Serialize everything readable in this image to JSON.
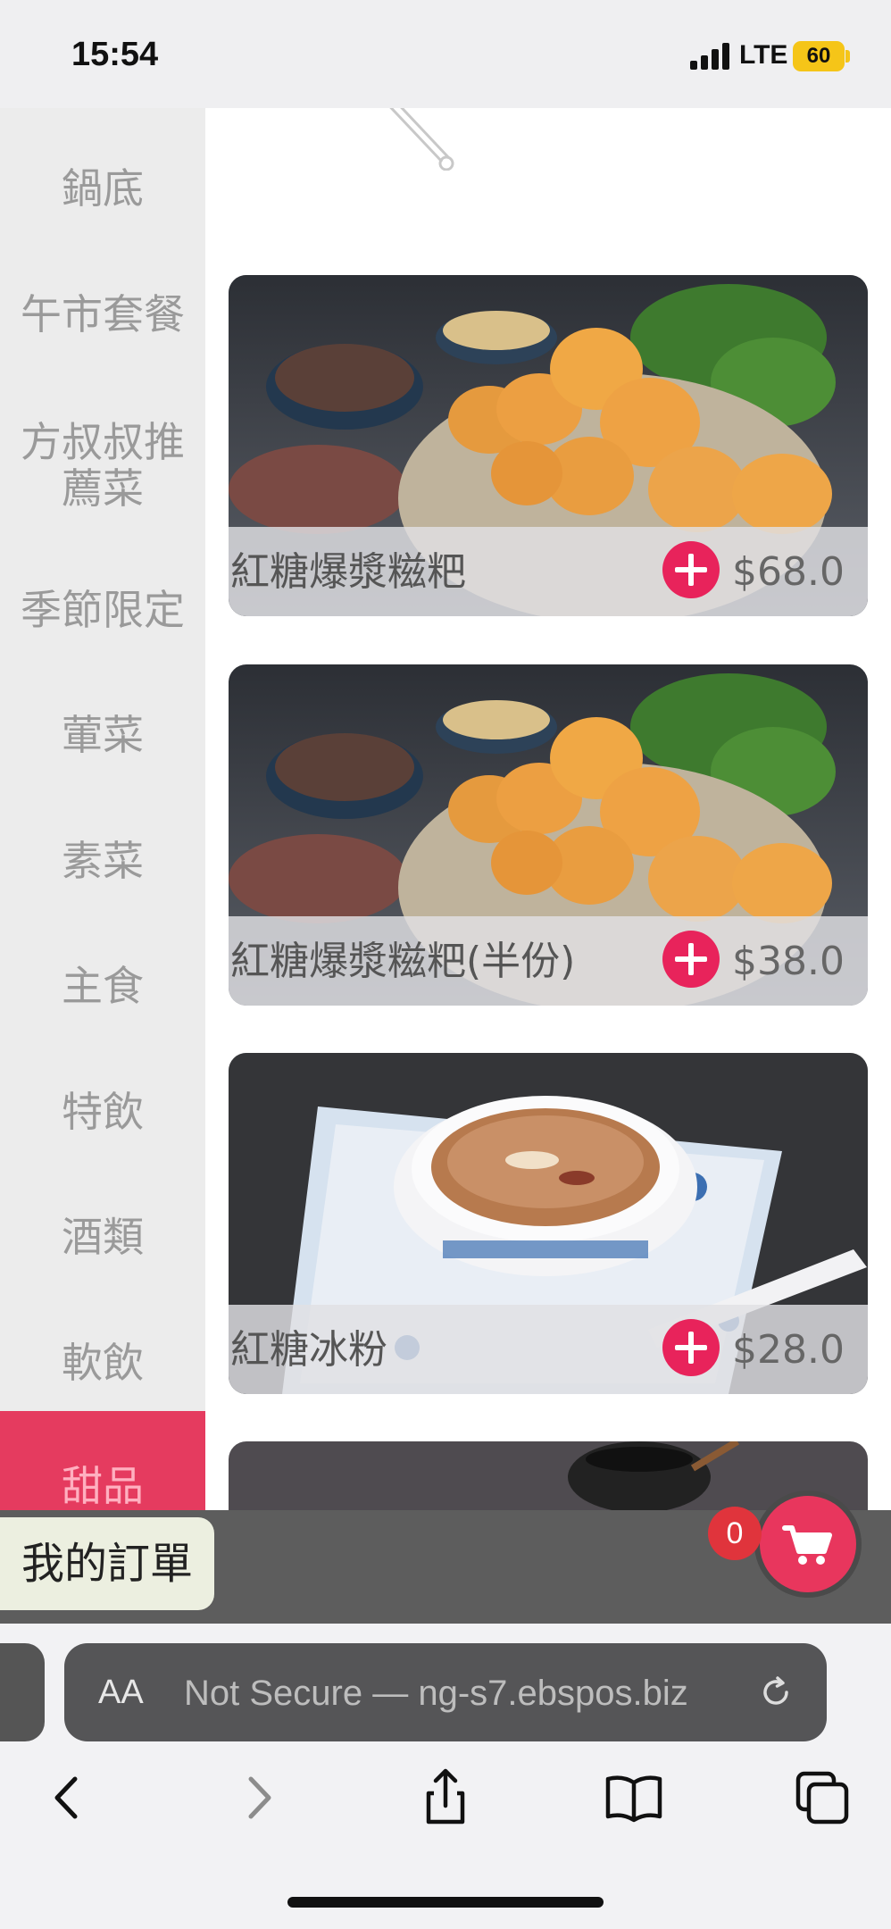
{
  "status_bar": {
    "time": "15:54",
    "network": "LTE",
    "battery": "60",
    "battery_color": "#f5c518"
  },
  "sidebar": {
    "active_color": "#e53b5f",
    "items": [
      {
        "label": "鍋底"
      },
      {
        "label": "午市套餐"
      },
      {
        "label": "方叔叔推"
      },
      {
        "label": "薦菜"
      },
      {
        "label": "季節限定"
      },
      {
        "label": "葷菜"
      },
      {
        "label": "素菜"
      },
      {
        "label": "主食"
      },
      {
        "label": "特飲"
      },
      {
        "label": "酒類"
      },
      {
        "label": "軟飲"
      },
      {
        "label": "甜品"
      }
    ]
  },
  "menu_items": [
    {
      "name": "紅糖爆漿糍粑",
      "price": "$68.0",
      "image": "fried-glutinous-rice-cakes-photo"
    },
    {
      "name": "紅糖爆漿糍粑(半份)",
      "price": "$38.0",
      "image": "fried-glutinous-rice-cakes-photo"
    },
    {
      "name": "紅糖冰粉",
      "price": "$28.0",
      "image": "brown-sugar-ice-jelly-photo"
    },
    {
      "name": "",
      "price": "",
      "image": "dessert-photo-partial"
    }
  ],
  "order_bar": {
    "my_orders_label": "我的訂單",
    "cart_count": "0",
    "cart_icon": "shopping-cart-icon",
    "cart_color": "#e8365d"
  },
  "browser": {
    "text_size_label": "AA",
    "url": "Not Secure — ng-s7.ebspos.biz",
    "icons": [
      "back-icon",
      "forward-icon",
      "share-icon",
      "bookmarks-icon",
      "tabs-icon",
      "reload-icon"
    ]
  }
}
